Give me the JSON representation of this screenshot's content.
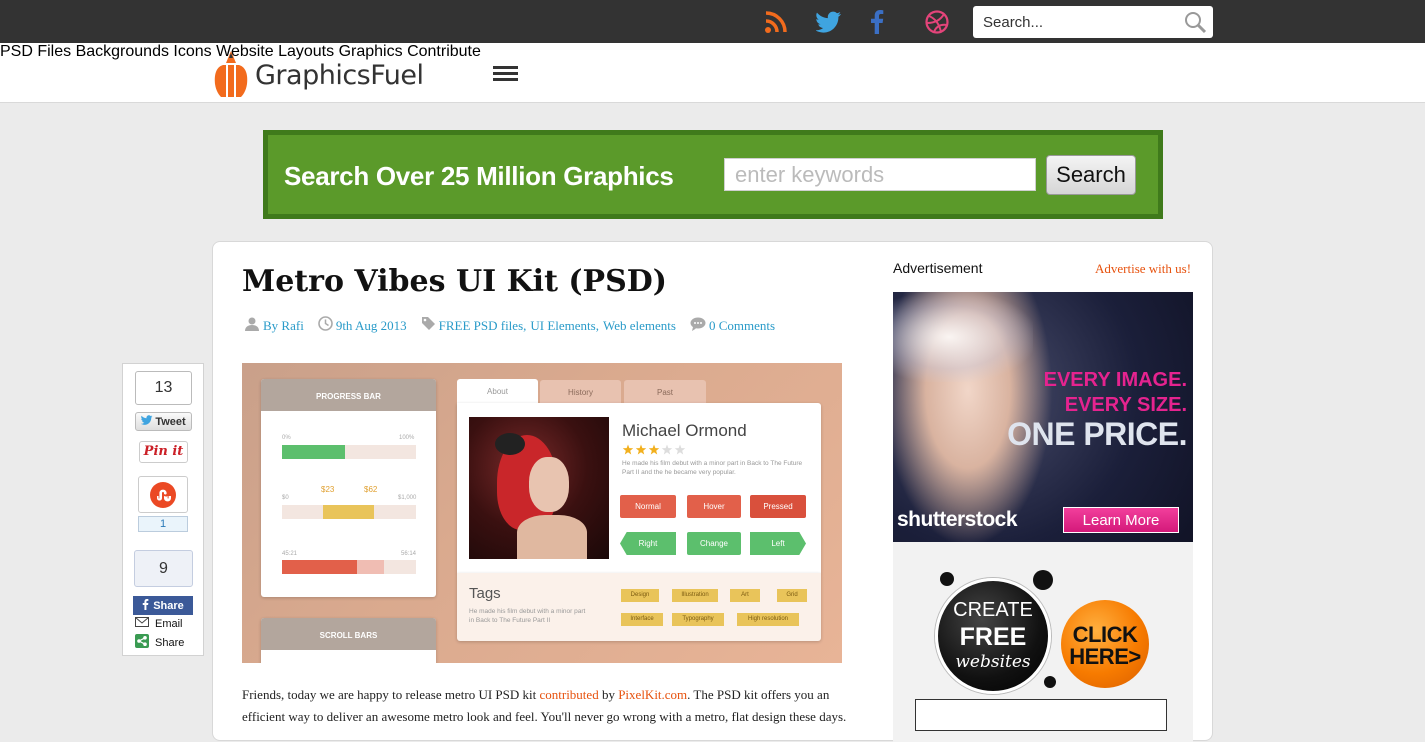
{
  "topbar": {
    "social_icons": [
      "rss-icon",
      "twitter-icon",
      "facebook-icon",
      "dribbble-icon"
    ],
    "search_placeholder": "Search..."
  },
  "header": {
    "logo_text": "GraphicsFuel",
    "nav": [
      "PSD Files",
      "Backgrounds",
      "Icons",
      "Website Layouts",
      "Graphics",
      "Contribute"
    ]
  },
  "banner": {
    "title": "Search Over 25 Million Graphics",
    "placeholder": "enter keywords",
    "button": "Search"
  },
  "post": {
    "title": "Metro Vibes UI Kit (PSD)",
    "author": "By Rafi",
    "date": "9th Aug 2013",
    "categories": [
      "FREE PSD files",
      "UI Elements",
      "Web elements"
    ],
    "comments": "0 Comments",
    "body_start": "Friends, today we are happy to release metro UI PSD kit ",
    "body_link1": "contributed",
    "body_mid": " by ",
    "body_link2": "PixelKit.com",
    "body_rest": ". The PSD kit offers you an efficient way to deliver an awesome metro look and feel. You'll never go wrong with a metro, flat design these days."
  },
  "preview": {
    "progress_title": "PROGRESS BAR",
    "scroll_title": "SCROLL BARS",
    "p1_min": "0%",
    "p1_max": "100%",
    "p1_value": 0.47,
    "p2_min": "$0",
    "p2_max": "$1,000",
    "p2_low": "$23",
    "p2_high": "$62",
    "p3_min": "45:21",
    "p3_max": "56:14",
    "tabs": [
      "About",
      "History",
      "Past"
    ],
    "name": "Michael Ormond",
    "rating": 3,
    "bio": "He made his film debut with a minor part in Back to The Future Part II and the he became very popular.",
    "buttons_row1": [
      "Normal",
      "Hover",
      "Pressed"
    ],
    "buttons_row2": [
      "Right",
      "Change",
      "Left"
    ],
    "tags_title": "Tags",
    "tags_text": "He made his film debut with a minor part in Back to The Future Part II",
    "tags": [
      "Design",
      "Illustration",
      "Art",
      "Grid",
      "Interface",
      "Typography",
      "High resolution"
    ]
  },
  "share": {
    "tweet_count": "13",
    "tweet_label": "Tweet",
    "pin_label": "Pin it",
    "stumble_count": "1",
    "fb_count": "9",
    "fb_label": "Share",
    "email_label": "Email",
    "share_label": "Share"
  },
  "sidebar": {
    "advertisement": "Advertisement",
    "advertise_link": "Advertise with us!",
    "ad1_line1": "EVERY IMAGE.",
    "ad1_line2": "EVERY SIZE.",
    "ad1_line3": "ONE PRICE.",
    "ad1_brand": "shutterstock",
    "ad1_button": "Learn More",
    "ad2_create": "CREATE",
    "ad2_free": "FREE",
    "ad2_websites": "websites",
    "ad2_click": "CLICK",
    "ad2_here": "HERE>"
  },
  "colors": {
    "topbar": "#333333",
    "accent_orange": "#e7520e",
    "link_blue": "#2a9bc9",
    "banner_green": "#5b9a2a"
  }
}
